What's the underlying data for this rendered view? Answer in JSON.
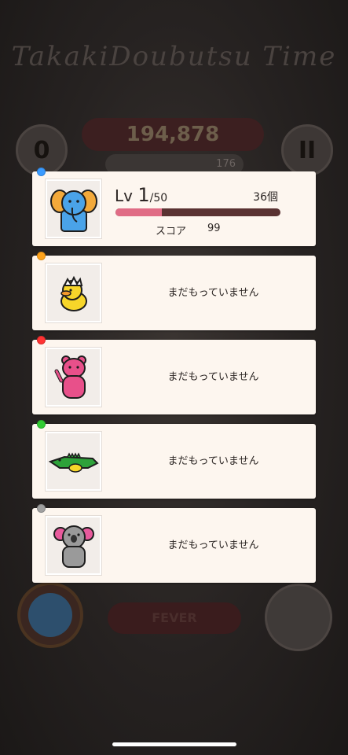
{
  "background": {
    "title_line": "TakakiDoubutsu Time",
    "score": "194,878",
    "sub_value": "176",
    "left_button": "0",
    "right_button": "II",
    "fever_label": "FEVER"
  },
  "cards": [
    {
      "pin_color": "#3a9bff",
      "character": "elephant-icon",
      "owned": true,
      "level_prefix": "Lv",
      "level": "1",
      "level_max": "/50",
      "count": "36個",
      "progress": 0.28,
      "score_label": "スコア",
      "score": "99"
    },
    {
      "pin_color": "#ffa31a",
      "character": "chick-icon",
      "owned": false,
      "empty_text": "まだもっていません"
    },
    {
      "pin_color": "#ff3333",
      "character": "bear-icon",
      "owned": false,
      "empty_text": "まだもっていません"
    },
    {
      "pin_color": "#33cc33",
      "character": "crocodile-icon",
      "owned": false,
      "empty_text": "まだもっていません"
    },
    {
      "pin_color": "#a0a0a0",
      "character": "koala-icon",
      "owned": false,
      "empty_text": "まだもっていません"
    }
  ]
}
